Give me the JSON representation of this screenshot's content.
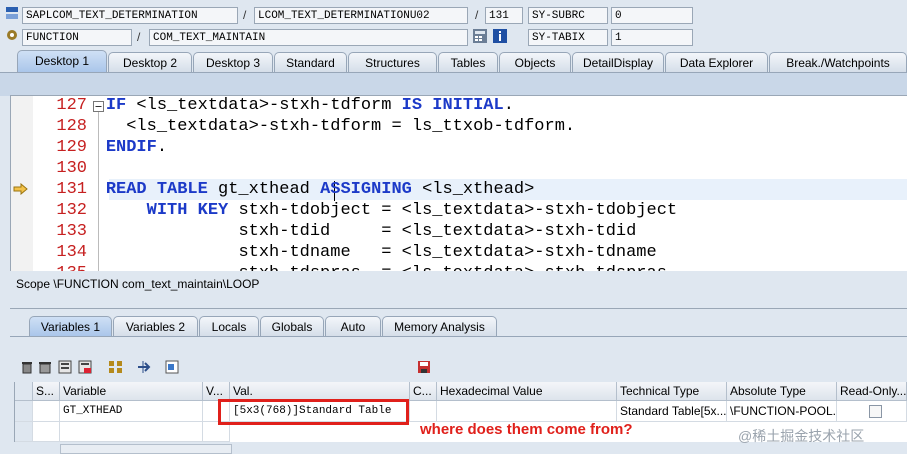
{
  "header": {
    "row1": {
      "program": "SAPLCOM_TEXT_DETERMINATION",
      "include": "LCOM_TEXT_DETERMINATIONU02",
      "line": "131",
      "sysvar_label": "SY-SUBRC",
      "sysvar_value": "0"
    },
    "row2": {
      "event_type": "FUNCTION",
      "event_name": "COM_TEXT_MAINTAIN",
      "sysvar_label": "SY-TABIX",
      "sysvar_value": "1"
    },
    "separator": "/"
  },
  "desktop_tabs": [
    "Desktop 1",
    "Desktop 2",
    "Desktop 3",
    "Standard",
    "Structures",
    "Tables",
    "Objects",
    "DetailDisplay",
    "Data Explorer",
    "Break./Watchpoints"
  ],
  "code": {
    "lines": [
      {
        "num": "127",
        "parts": [
          [
            "kw",
            "IF "
          ],
          [
            "",
            "<ls_textdata>-stxh-tdform "
          ],
          [
            "kw",
            "IS INITIAL"
          ],
          [
            "",
            "."
          ]
        ],
        "indent": "    "
      },
      {
        "num": "128",
        "parts": [
          [
            "",
            "<ls_textdata>-stxh-tdform = ls_ttxob-tdform."
          ]
        ],
        "indent": "      "
      },
      {
        "num": "129",
        "parts": [
          [
            "kw",
            "ENDIF"
          ],
          [
            "",
            "."
          ]
        ],
        "indent": "    "
      },
      {
        "num": "130",
        "parts": [],
        "indent": ""
      },
      {
        "num": "131",
        "parts": [
          [
            "kw",
            "READ TABLE "
          ],
          [
            "",
            "gt_xthead "
          ],
          [
            "kw",
            "ASSIGNING "
          ],
          [
            "",
            "<ls_xthead>"
          ]
        ],
        "indent": "    "
      },
      {
        "num": "132",
        "parts": [
          [
            "kw",
            "WITH KEY "
          ],
          [
            "",
            "stxh-tdobject = <ls_textdata>-stxh-tdobject"
          ]
        ],
        "indent": "        "
      },
      {
        "num": "133",
        "parts": [
          [
            "",
            "stxh-tdid     = <ls_textdata>-stxh-tdid"
          ]
        ],
        "indent": "                 "
      },
      {
        "num": "134",
        "parts": [
          [
            "",
            "stxh-tdname   = <ls_textdata>-stxh-tdname"
          ]
        ],
        "indent": "                 "
      },
      {
        "num": "135",
        "parts": [
          [
            "",
            "stxh-tdspras  = <ls_textdata>-stxh-tdspras"
          ]
        ],
        "indent": "                 "
      }
    ]
  },
  "scope": "Scope \\FUNCTION com_text_maintain\\LOOP",
  "variable_tabs": [
    "Variables 1",
    "Variables 2",
    "Locals",
    "Globals",
    "Auto",
    "Memory Analysis"
  ],
  "table": {
    "headers": [
      "S...",
      "Variable",
      "V...",
      "Val.",
      "C...",
      "Hexadecimal Value",
      "Technical Type",
      "Absolute Type",
      "Read-Only..."
    ],
    "row": {
      "variable": "GT_XTHEAD",
      "value": "[5x3(768)]Standard Table",
      "technical_type": "Standard Table[5x...",
      "absolute_type": "\\FUNCTION-POOL..."
    }
  },
  "annotation": "where does them come from?",
  "watermark": "@稀土掘金技术社区",
  "colors": {
    "keyword": "#1c3ac8",
    "line_number": "#c62020",
    "annotation": "#e0201b",
    "highlight_box": "#e0201b"
  }
}
